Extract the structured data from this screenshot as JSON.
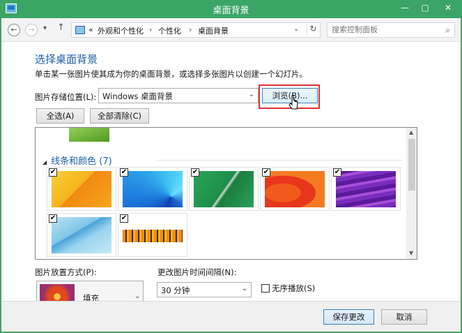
{
  "window": {
    "title": "桌面背景",
    "min_label": "—",
    "max_label": "▢",
    "close_label": "✕"
  },
  "nav": {
    "back": "←",
    "forward": "→",
    "recent": "▾",
    "up": "↑",
    "breadcrumb_sep": "«",
    "breadcrumb": [
      "外观和个性化",
      "个性化",
      "桌面背景"
    ],
    "sep": "›",
    "refresh": "↻",
    "dropdown": "⌄"
  },
  "search": {
    "placeholder": "搜索控制面板",
    "icon": "search-icon"
  },
  "main": {
    "heading": "选择桌面背景",
    "description": "单击某一张图片使其成为你的桌面背景，或选择多张图片以创建一个幻灯片。",
    "location_label": "图片存储位置(L):",
    "location_value": "Windows 桌面背景",
    "browse_label": "浏览(B)...",
    "select_all_label": "全选(A)",
    "clear_all_label": "全部清除(C)"
  },
  "gallery": {
    "group_title": "线条和颜色 (7)",
    "group_toggle": "◢",
    "check_glyph": "✔",
    "items": [
      {
        "name": "orange-lines",
        "checked": true
      },
      {
        "name": "blue-fan",
        "checked": true
      },
      {
        "name": "green-lines",
        "checked": true
      },
      {
        "name": "red-orange-shapes",
        "checked": true
      },
      {
        "name": "purple-waves",
        "checked": true
      },
      {
        "name": "light-blue-lines",
        "checked": true
      },
      {
        "name": "orange-bars",
        "checked": true
      }
    ],
    "scroll_up": "▲",
    "scroll_down": "▼"
  },
  "bottom": {
    "position_label": "图片放置方式(P):",
    "position_value": "填充",
    "position_arrow": "⌄",
    "interval_label": "更改图片时间间隔(N):",
    "interval_value": "30 分钟",
    "interval_arrow": "⌄",
    "shuffle_label": "无序播放(S)",
    "shuffle_checked": false
  },
  "footer": {
    "save_label": "保存更改",
    "cancel_label": "取消"
  },
  "colors": {
    "title_bar": "#3aa565",
    "heading": "#1d5fa8",
    "highlight": "#e03030"
  }
}
